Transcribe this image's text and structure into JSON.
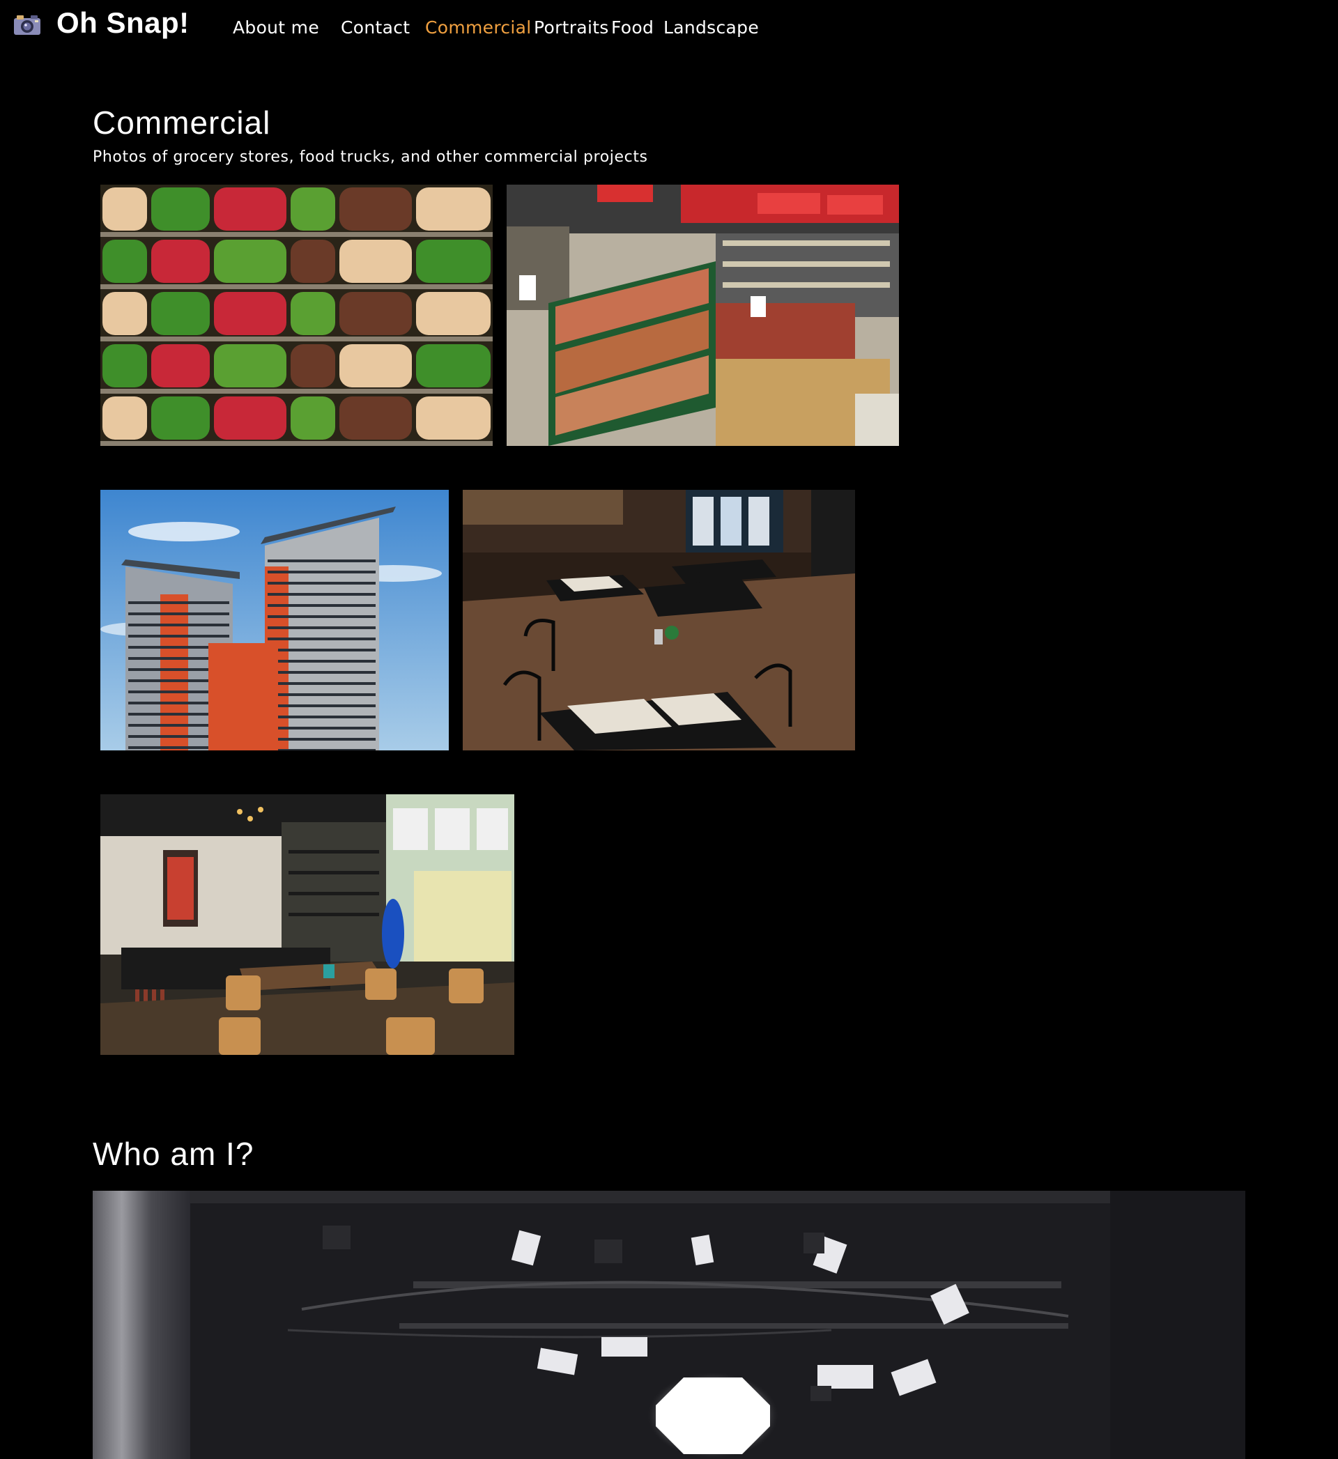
{
  "nav": {
    "brand": "Oh Snap!",
    "logo_icon": "camera-icon",
    "links": [
      {
        "label": "About me"
      },
      {
        "label": "Contact"
      },
      {
        "label": "Commercial",
        "active": true
      },
      {
        "label": "Portraits"
      },
      {
        "label": "Food"
      },
      {
        "label": "Landscape"
      }
    ],
    "active_color": "#f0a040"
  },
  "commercial": {
    "title": "Commercial",
    "subtitle": "Photos of grocery stores, food trucks, and other commercial projects",
    "photos": [
      {
        "subject": "produce-shelves"
      },
      {
        "subject": "supermarket-aisle"
      },
      {
        "subject": "apartment-towers"
      },
      {
        "subject": "restaurant-dining-room"
      },
      {
        "subject": "cafe-interior"
      }
    ]
  },
  "about": {
    "title": "Who am I?",
    "photo": {
      "subject": "photo-studio-lights"
    }
  }
}
